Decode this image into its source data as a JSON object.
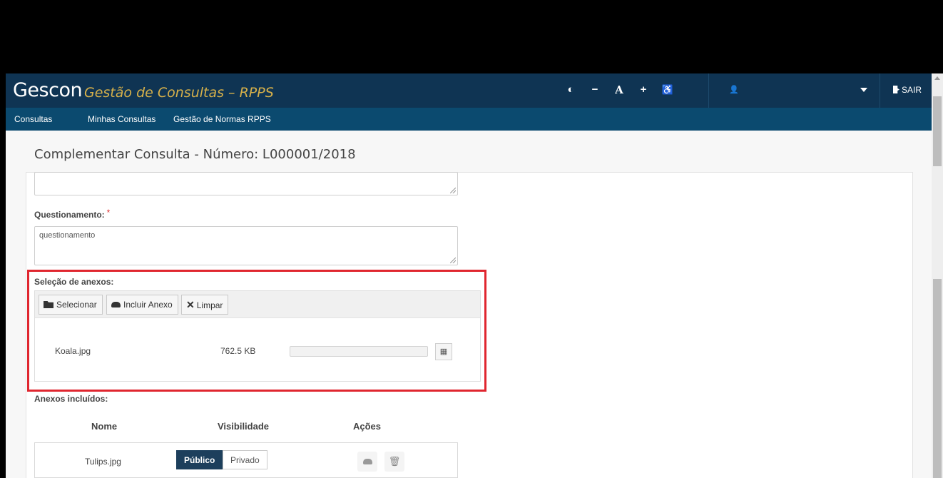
{
  "header": {
    "brand": "Gescon",
    "subtitle": "Gestão de Consultas – RPPS",
    "tools": {
      "contrast": "◐",
      "decrease": "−",
      "font": "A",
      "increase": "+",
      "accessibility": "♿",
      "user": "👤"
    },
    "logout": "SAIR"
  },
  "nav": {
    "items": [
      "Consultas",
      "Minhas Consultas",
      "Gestão de Normas RPPS"
    ]
  },
  "page": {
    "title": "Complementar Consulta - Número: L000001/2018"
  },
  "form": {
    "questionamento_label": "Questionamento:",
    "required_mark": "*",
    "questionamento_value": "questionamento",
    "attachments_label": "Seleção de anexos:",
    "buttons": {
      "select": "Selecionar",
      "include": "Incluir Anexo",
      "clear": "Limpar"
    },
    "pending_file": {
      "name": "Koala.jpg",
      "size": "762.5 KB",
      "progress": 0
    },
    "included_label": "Anexos incluídos:",
    "table": {
      "headers": [
        "Nome",
        "Visibilidade",
        "Ações"
      ],
      "rows": [
        {
          "name": "Tulips.jpg",
          "public": "Público",
          "private": "Privado"
        }
      ]
    }
  },
  "colors": {
    "header_bg": "#0f3453",
    "nav_bg": "#0b4a6f",
    "subtitle": "#d6b04a",
    "highlight": "#e0262f"
  }
}
